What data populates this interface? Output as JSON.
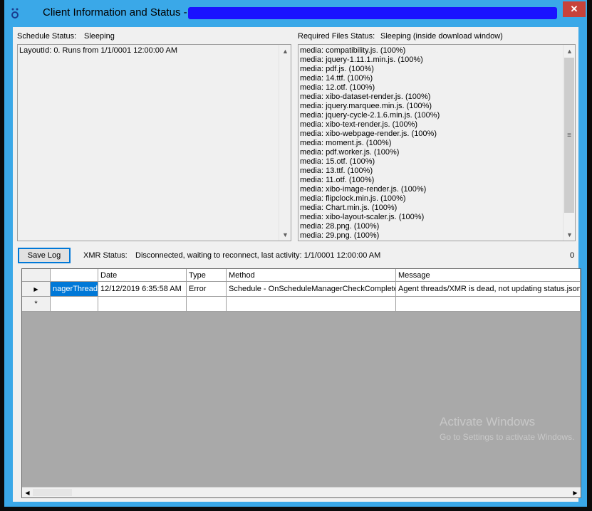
{
  "window": {
    "title": "Client Information and Status -",
    "close_glyph": "✕"
  },
  "schedule": {
    "label": "Schedule Status:",
    "value": "Sleeping",
    "lines": [
      "LayoutId: 0. Runs from 1/1/0001 12:00:00 AM"
    ]
  },
  "required_files": {
    "label": "Required Files Status:",
    "value": "Sleeping (inside download window)",
    "lines": [
      "media: compatibility.js. (100%)",
      "media: jquery-1.11.1.min.js. (100%)",
      "media: pdf.js. (100%)",
      "media: 14.ttf. (100%)",
      "media: 12.otf. (100%)",
      "media: xibo-dataset-render.js. (100%)",
      "media: jquery.marquee.min.js. (100%)",
      "media: jquery-cycle-2.1.6.min.js. (100%)",
      "media: xibo-text-render.js. (100%)",
      "media: xibo-webpage-render.js. (100%)",
      "media: moment.js. (100%)",
      "media: pdf.worker.js. (100%)",
      "media: 15.otf. (100%)",
      "media: 13.ttf. (100%)",
      "media: 11.otf. (100%)",
      "media: xibo-image-render.js. (100%)",
      "media: flipclock.min.js. (100%)",
      "media: Chart.min.js. (100%)",
      "media: xibo-layout-scaler.js. (100%)",
      "media: 28.png. (100%)",
      "media: 29.png. (100%)"
    ]
  },
  "toolbar": {
    "save_log_label": "Save Log",
    "xmr_label": "XMR Status:",
    "xmr_value": "Disconnected, waiting to reconnect, last activity: 1/1/0001 12:00:00 AM",
    "count": "0"
  },
  "log_grid": {
    "columns": [
      "",
      "Date",
      "Type",
      "Method",
      "Message"
    ],
    "rows": [
      {
        "thread": "nagerThread",
        "date": "12/12/2019 6:35:58 AM",
        "type": "Error",
        "method": "Schedule - OnScheduleManagerCheckComplete",
        "message": "Agent threads/XMR is dead, not updating status.json"
      }
    ],
    "new_row_glyph": "*",
    "current_row_glyph": "▶"
  },
  "watermark": {
    "line1": "Activate Windows",
    "line2": "Go to Settings to activate Windows."
  },
  "icons": {
    "scroll_up": "▲",
    "scroll_down": "▼",
    "scroll_left": "◀",
    "scroll_right": "▶",
    "grip": "≡"
  },
  "colors": {
    "title_bar": "#3aa8e8",
    "close_button": "#c7423a",
    "selection": "#0078d7",
    "grid_background": "#a9a9a9"
  }
}
